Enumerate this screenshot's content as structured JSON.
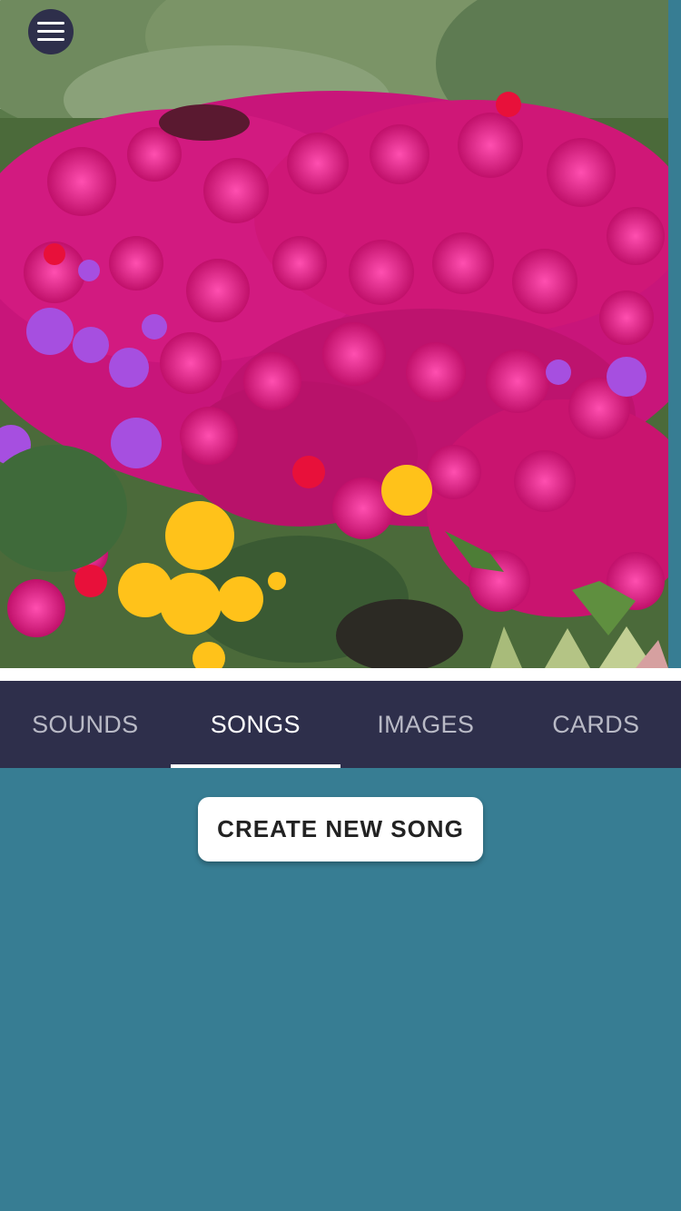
{
  "header": {
    "menu_icon": "hamburger-menu-icon",
    "hero_image": "pink-purple-yellow-ice-plant-flowers-photo"
  },
  "tabs": [
    {
      "label": "SOUNDS",
      "active": false
    },
    {
      "label": "SONGS",
      "active": true
    },
    {
      "label": "IMAGES",
      "active": false
    },
    {
      "label": "CARDS",
      "active": false
    }
  ],
  "main": {
    "create_button_label": "CREATE NEW SONG"
  },
  "colors": {
    "background": "#377d93",
    "tab_bar": "#2e2f4b",
    "menu_button": "#2e2f4b",
    "button_bg": "#ffffff"
  }
}
